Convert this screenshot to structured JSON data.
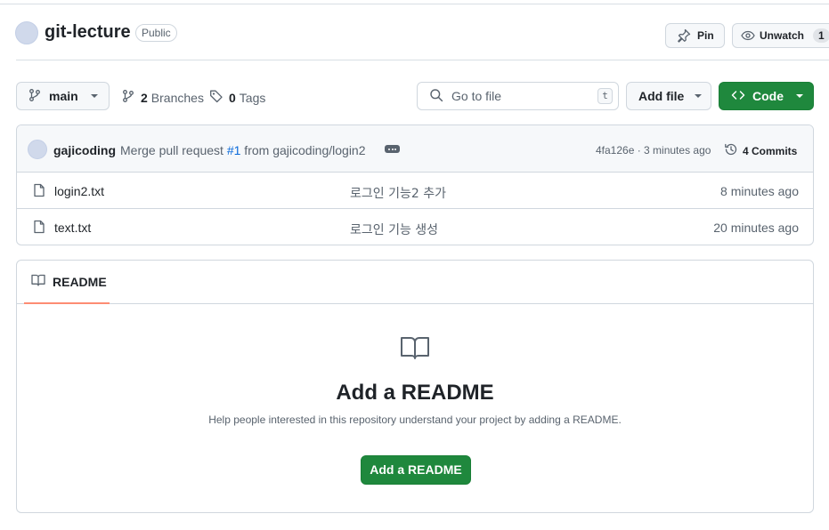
{
  "repo": {
    "name": "git-lecture",
    "visibility": "Public",
    "pin_label": "Pin",
    "watch_label": "Unwatch",
    "watch_count": "1"
  },
  "toolbar": {
    "branch": "main",
    "branches_count": "2",
    "branches_label": "Branches",
    "tags_count": "0",
    "tags_label": "Tags",
    "goto_placeholder": "Go to file",
    "goto_shortcut": "t",
    "add_file_label": "Add file",
    "code_label": "Code"
  },
  "latest_commit": {
    "author": "gajicoding",
    "message_prefix": "Merge pull request ",
    "pr_ref": "#1",
    "message_suffix": " from gajicoding/login2",
    "sha_time": "4fa126e · 3 minutes ago",
    "commits_label": "4 Commits"
  },
  "files": [
    {
      "name": "login2.txt",
      "commit_message": "로그인 기능2 추가",
      "time": "8 minutes ago"
    },
    {
      "name": "text.txt",
      "commit_message": "로그인 기능 생성",
      "time": "20 minutes ago"
    }
  ],
  "readme": {
    "tab_label": "README",
    "title": "Add a README",
    "description": "Help people interested in this repository understand your project by adding a README.",
    "button_label": "Add a README"
  },
  "colors": {
    "primary_green": "#1f883d",
    "link_blue": "#0969da",
    "tab_underline": "#fd8c73",
    "muted_text": "#59636e",
    "border": "#d0d7de"
  },
  "icons": {
    "pin": "pin-icon",
    "eye": "eye-icon",
    "branch": "git-branch-icon",
    "tag": "tag-icon",
    "search": "search-icon",
    "code": "code-icon",
    "history": "history-icon",
    "file": "file-icon",
    "book": "book-icon"
  }
}
